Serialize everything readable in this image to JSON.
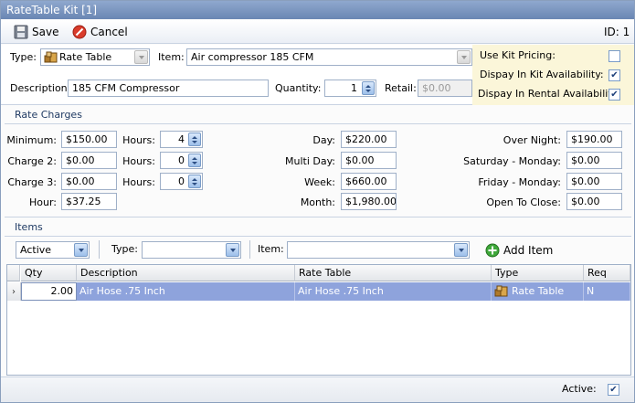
{
  "window": {
    "title": "RateTable Kit [1]"
  },
  "toolbar": {
    "save_label": "Save",
    "cancel_label": "Cancel",
    "id_label": "ID: 1"
  },
  "header": {
    "type_label": "Type:",
    "type_value": "Rate Table",
    "item_label": "Item:",
    "item_value": "Air compressor 185 CFM",
    "description_label": "Description:",
    "description_value": "185 CFM Compressor",
    "quantity_label": "Quantity:",
    "quantity_value": "1",
    "retail_label": "Retail:",
    "retail_value": "$0.00"
  },
  "kit_options": {
    "use_kit_pricing_label": "Use Kit Pricing:",
    "use_kit_pricing": false,
    "kit_availability_label": "Dispay In Kit Availability:",
    "kit_availability": true,
    "rental_availability_label": "Dispay In Rental Availability:",
    "rental_availability": true
  },
  "rate_charges": {
    "section_title": "Rate Charges",
    "minimum_label": "Minimum:",
    "minimum_value": "$150.00",
    "charge2_label": "Charge 2:",
    "charge2_value": "$0.00",
    "charge3_label": "Charge 3:",
    "charge3_value": "$0.00",
    "hour_label": "Hour:",
    "hour_value": "$37.25",
    "hours1_label": "Hours:",
    "hours1_value": "4",
    "hours2_label": "Hours:",
    "hours2_value": "0",
    "hours3_label": "Hours:",
    "hours3_value": "0",
    "day_label": "Day:",
    "day_value": "$220.00",
    "multiday_label": "Multi Day:",
    "multiday_value": "$0.00",
    "week_label": "Week:",
    "week_value": "$660.00",
    "month_label": "Month:",
    "month_value": "$1,980.00",
    "overnight_label": "Over Night:",
    "overnight_value": "$190.00",
    "satmon_label": "Saturday - Monday:",
    "satmon_value": "$0.00",
    "frimon_label": "Friday - Monday:",
    "frimon_value": "$0.00",
    "opentoclose_label": "Open To Close:",
    "opentoclose_value": "$0.00"
  },
  "items": {
    "section_title": "Items",
    "filter_value": "Active",
    "type_label": "Type:",
    "type_value": "",
    "item_label": "Item:",
    "item_value": "",
    "add_item_label": "Add Item",
    "columns": [
      "Qty",
      "Description",
      "Rate Table",
      "Type",
      "Req"
    ],
    "rows": [
      {
        "qty": "2.00",
        "description": "Air Hose .75 Inch",
        "rate_table": "Air Hose .75 Inch",
        "type": "Rate Table",
        "req": "N"
      }
    ]
  },
  "footer": {
    "active_label": "Active:",
    "active": true
  },
  "colors": {
    "accent": "#6a86b3",
    "selected_row": "#8ea3dc",
    "kit_panel": "#fbf6d9"
  },
  "icons": {
    "save": "floppy-disk-icon",
    "cancel": "cancel-icon",
    "type": "rate-table-icon",
    "add": "add-icon"
  }
}
